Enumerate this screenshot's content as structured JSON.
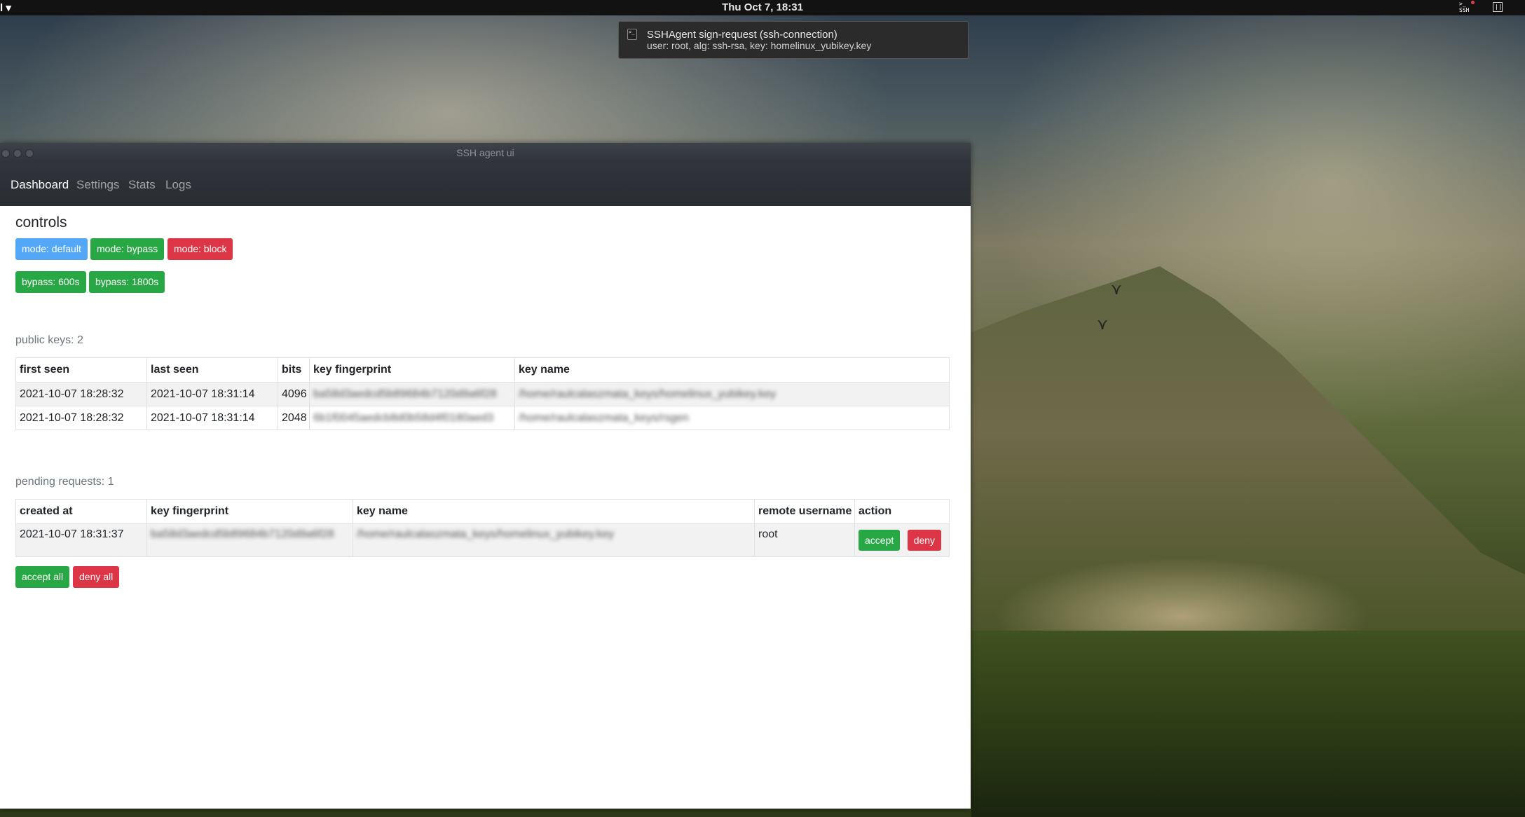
{
  "topbar": {
    "left_fragment": "l ▾",
    "clock": "Thu Oct  7, 18:31",
    "tray_ssh_label": "SSH"
  },
  "notification": {
    "icon_text": ">_",
    "title": "SSHAgent sign-request (ssh-connection)",
    "body": "user: root, alg: ssh-rsa, key: homelinux_yubikey.key"
  },
  "window": {
    "title": "SSH agent ui"
  },
  "nav": {
    "items": [
      {
        "label": "Dashboard",
        "active": true
      },
      {
        "label": "Settings",
        "active": false
      },
      {
        "label": "Stats",
        "active": false
      },
      {
        "label": "Logs",
        "active": false
      }
    ]
  },
  "controls": {
    "heading": "controls",
    "mode_buttons": [
      "mode: default",
      "mode: bypass",
      "mode: block"
    ],
    "bypass_buttons": [
      "bypass: 600s",
      "bypass: 1800s"
    ]
  },
  "public_keys": {
    "label": "public keys: 2",
    "columns": [
      "first seen",
      "last seen",
      "bits",
      "key fingerprint",
      "key name"
    ],
    "rows": [
      {
        "first_seen": "2021-10-07 18:28:32",
        "last_seen": "2021-10-07 18:31:14",
        "bits": "4096",
        "fingerprint": "ba58d3aedcd5b89684b7120d9a6f28",
        "name": "/home/raulcalaszmata_keys/homelinux_yubikey.key"
      },
      {
        "first_seen": "2021-10-07 18:28:32",
        "last_seen": "2021-10-07 18:31:14",
        "bits": "2048",
        "fingerprint": "6b1f0045aedcb8d0b58d4f0180aed3",
        "name": "/home/raulcalaszmata_keys/rsgen"
      }
    ]
  },
  "pending": {
    "label": "pending requests: 1",
    "columns": [
      "created at",
      "key fingerprint",
      "key name",
      "remote username",
      "action"
    ],
    "rows": [
      {
        "created_at": "2021-10-07 18:31:37",
        "fingerprint": "ba58d3aedcd5b89684b7120d9a6f28",
        "name": "/home/raulcalaszmata_keys/homelinux_yubikey.key",
        "remote_username": "root",
        "accept_label": "accept",
        "deny_label": "deny"
      }
    ],
    "accept_all": "accept all",
    "deny_all": "deny all"
  },
  "colors": {
    "blue": "#52a8f7",
    "green": "#28a745",
    "red": "#dc3545",
    "navbar": "#2d3136"
  }
}
